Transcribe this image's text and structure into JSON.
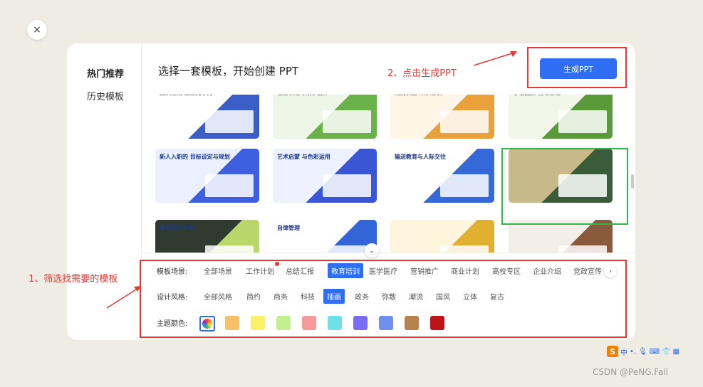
{
  "close_label": "×",
  "sidebar": {
    "items": [
      {
        "label": "热门推荐",
        "active": true
      },
      {
        "label": "历史模板",
        "active": false
      }
    ]
  },
  "header": {
    "title": "选择一套模板，开始创建 PPT"
  },
  "generate_button": {
    "label": "生成PPT"
  },
  "templates": [
    {
      "title": "团队建设 企业竞争力",
      "colors": [
        "#ffffff",
        "#3b5fc7"
      ]
    },
    {
      "title": "语言表达与故事创作",
      "colors": [
        "#eef6e8",
        "#6bb14c"
      ]
    },
    {
      "title": "消防安全 知识普及",
      "colors": [
        "#fff6e8",
        "#e9a23b"
      ]
    },
    {
      "title": "心理健康 情绪管理",
      "colors": [
        "#f2f7ea",
        "#5a9a3a"
      ]
    },
    {
      "title": "新人入职的 目标设定与规划",
      "colors": [
        "#eaf0ff",
        "#3e5fe0"
      ]
    },
    {
      "title": "艺术启蒙 与色彩运用",
      "colors": [
        "#eef1ff",
        "#3a56d4"
      ]
    },
    {
      "title": "输送教育与人际交往",
      "colors": [
        "#ffffff",
        "#3568d8"
      ]
    },
    {
      "title": "",
      "colors": [
        "#c8b98a",
        "#3b5c3a"
      ]
    },
    {
      "title": "暑期运动伤害",
      "colors": [
        "#2f3b2f",
        "#b9d66b"
      ]
    },
    {
      "title": "自律管理",
      "colors": [
        "#ffffff",
        "#3465d8"
      ]
    },
    {
      "title": "",
      "colors": [
        "#fff4dc",
        "#e0b02e"
      ]
    },
    {
      "title": "",
      "colors": [
        "#f3eee8",
        "#8a5a3c"
      ]
    }
  ],
  "filters": {
    "scene": {
      "label": "模板场景:",
      "options": [
        "全部场景",
        "工作计划",
        "总结汇报",
        "教育培训",
        "医学医疗",
        "营销推广",
        "商业计划",
        "高校专区",
        "企业介绍",
        "党政宣传"
      ],
      "selected": "教育培训"
    },
    "style": {
      "label": "设计风格:",
      "options": [
        "全部风格",
        "简约",
        "商务",
        "科技",
        "插画",
        "政务",
        "弥散",
        "潮流",
        "国风",
        "立体",
        "复古"
      ],
      "selected": "插画"
    },
    "color": {
      "label": "主题颜色:",
      "swatches": [
        "#f9c06a",
        "#fbf06a",
        "#c3f08e",
        "#f79a9a",
        "#6fe0ea",
        "#7b6cf6",
        "#6f8ff0",
        "#b8824e",
        "#c0121a"
      ]
    }
  },
  "annotations": {
    "step1": "1、筛选找需要的模板",
    "step2": "2、点击生成PPT"
  },
  "more_label": "›",
  "collapse_label": "⌄",
  "ime": {
    "logo": "S",
    "mode": "中"
  },
  "watermark": "CSDN @PeNG.Fall"
}
